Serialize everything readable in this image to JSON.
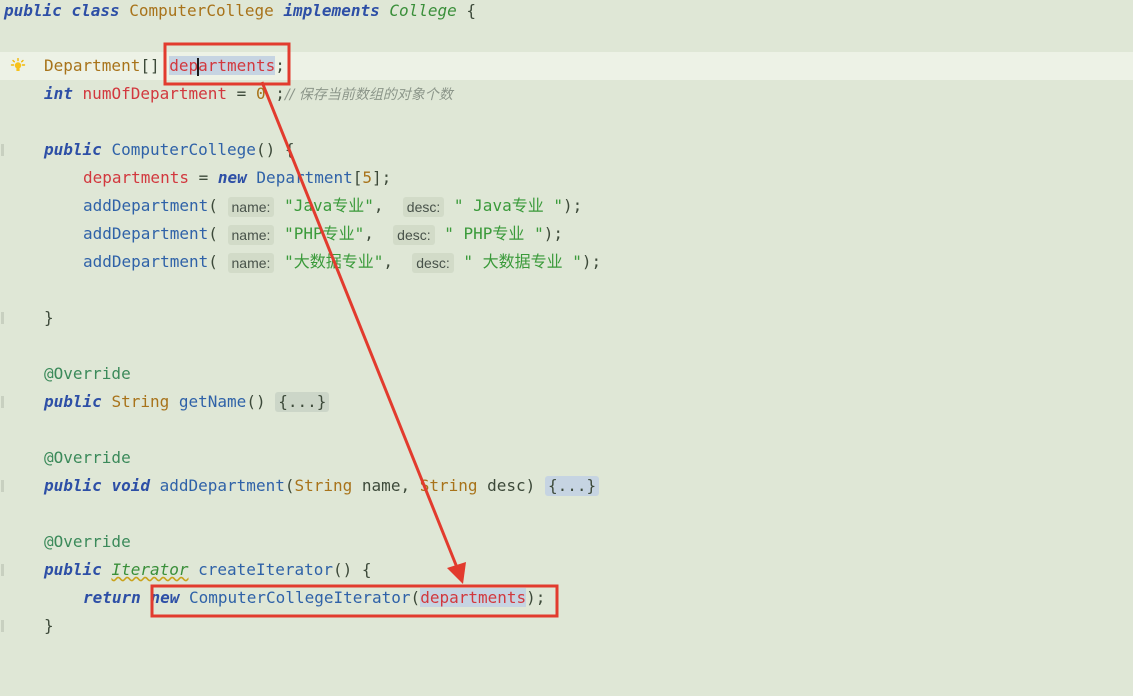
{
  "code": {
    "class_decl": {
      "kw1": "public",
      "kw2": "class",
      "name": "ComputerCollege",
      "kw3": "implements",
      "iface": "College",
      "brace": " {"
    },
    "field1": {
      "type": "Department",
      "arr": "[] ",
      "name_a": "dep",
      "name_b": "artments",
      "semi": ";"
    },
    "field2": {
      "kw": "int",
      "name": "numOfDepartment",
      "eq": " = ",
      "val": "0",
      "rest": " ;",
      "comment": "// 保存当前数组的对象个数"
    },
    "ctor": {
      "kw": "public",
      "name": "ComputerCollege",
      "sig": "() {"
    },
    "ctor_line1": {
      "field": "departments",
      "eq": " = ",
      "kw": "new",
      "type": "Department",
      "open": "[",
      "num": "5",
      "close": "];"
    },
    "add_calls": [
      {
        "fn": "addDepartment",
        "open": "(",
        "hint_name": "name:",
        "arg1": "\"Java专业\"",
        "comma": ", ",
        "hint_desc": "desc:",
        "arg2": "\" Java专业 \"",
        "close": ");"
      },
      {
        "fn": "addDepartment",
        "open": "(",
        "hint_name": "name:",
        "arg1": "\"PHP专业\"",
        "comma": ", ",
        "hint_desc": "desc:",
        "arg2": "\" PHP专业 \"",
        "close": ");"
      },
      {
        "fn": "addDepartment",
        "open": "(",
        "hint_name": "name:",
        "arg1": "\"大数据专业\"",
        "comma": ", ",
        "hint_desc": "desc:",
        "arg2": "\" 大数据专业 \"",
        "close": ");"
      }
    ],
    "close_brace": "}",
    "override": "@Override",
    "getName": {
      "kw": "public",
      "type": "String",
      "name": "getName",
      "sig": "() ",
      "fold": "{...}"
    },
    "addDept": {
      "kw1": "public",
      "kw2": "void",
      "name": "addDepartment",
      "open": "(",
      "t1": "String",
      "p1": " name, ",
      "t2": "String",
      "p2": " desc) ",
      "fold": "{...}"
    },
    "createIter": {
      "kw": "public",
      "type": "Iterator",
      "name": "createIterator",
      "sig": "() {"
    },
    "ret": {
      "kw1": "return",
      "kw2": "new",
      "cls": "ComputerCollegeIterator",
      "open": "(",
      "arg": "departments",
      "close": ");"
    }
  },
  "colors": {
    "annotation_red": "#e23b2e",
    "background": "#dfe7d6",
    "current_line": "#edf2e6"
  },
  "icons": {
    "intention": "lightbulb-icon"
  }
}
